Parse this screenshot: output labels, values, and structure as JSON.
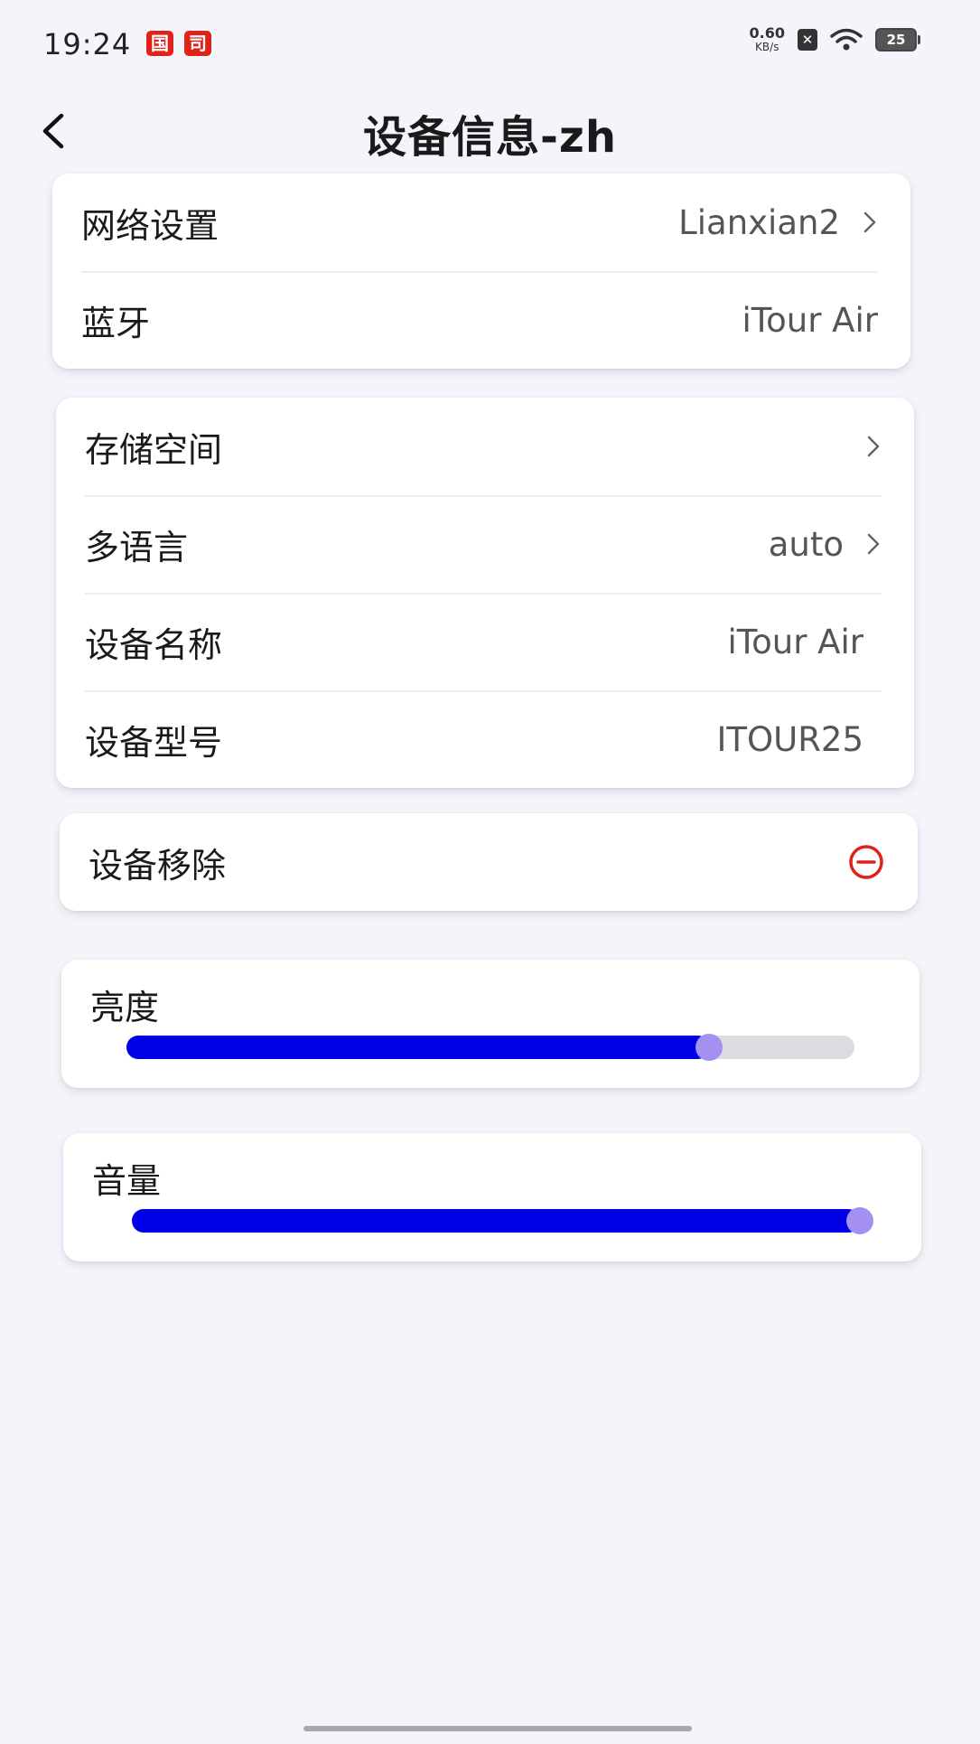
{
  "status_bar": {
    "time": "19:24",
    "notif_1": "国",
    "notif_2": "司",
    "net_speed_value": "0.60",
    "net_speed_unit": "KB/s",
    "sim_badge": "✕",
    "battery_level": "25"
  },
  "header": {
    "title": "设备信息-zh"
  },
  "network_card": {
    "rows": [
      {
        "label": "网络设置",
        "value": "Lianxian2",
        "has_chevron": true
      },
      {
        "label": "蓝牙",
        "value": "iTour Air",
        "has_chevron": false
      }
    ]
  },
  "device_card": {
    "rows": [
      {
        "label": "存储空间",
        "value": "",
        "has_chevron": true
      },
      {
        "label": "多语言",
        "value": "auto",
        "has_chevron": true
      },
      {
        "label": "设备名称",
        "value": "iTour Air",
        "has_chevron": false
      },
      {
        "label": "设备型号",
        "value": "ITOUR25",
        "has_chevron": false
      }
    ]
  },
  "remove_card": {
    "label": "设备移除",
    "icon": "remove-circle-icon"
  },
  "brightness": {
    "label": "亮度",
    "level_percent": 80
  },
  "volume": {
    "label": "音量",
    "level_percent": 100
  },
  "colors": {
    "slider_fill": "#0000e6",
    "slider_thumb": "#a490f0",
    "remove_icon": "#e0231a",
    "background": "#f4f4fb"
  }
}
